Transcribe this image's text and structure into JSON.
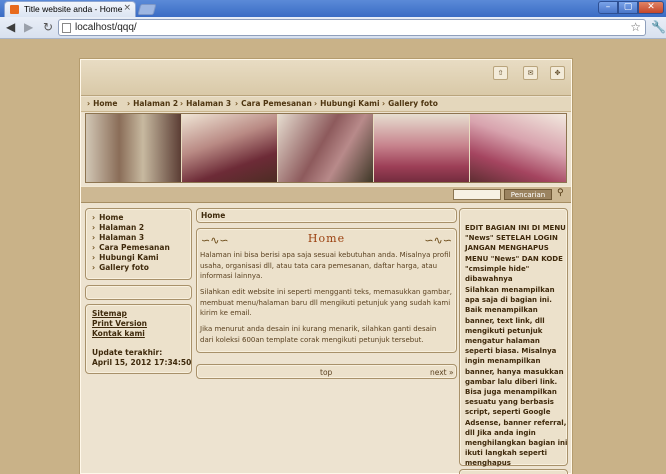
{
  "browser": {
    "tab_title": "Title website anda - Home",
    "tab_close": "×",
    "url": "localhost/qqq/",
    "controls": {
      "minimize": "–",
      "maximize": "▢",
      "close": "✕"
    },
    "nav": {
      "back": "◀",
      "forward": "▶",
      "reload": "↻",
      "star": "☆",
      "wrench": "🔧"
    }
  },
  "page": {
    "top_icons": [
      "⇧",
      "✉",
      "✥"
    ],
    "topnav": [
      "Home",
      "Halaman 2",
      "Halaman 3",
      "Cara Pemesanan",
      "Hubungi Kami",
      "Gallery foto"
    ],
    "arrow": "›",
    "search": {
      "button": "Pencarian",
      "icon": "⚲"
    },
    "sidebar": {
      "nav": [
        "Home",
        "Halaman 2",
        "Halaman 3",
        "Cara Pemesanan",
        "Hubungi Kami",
        "Gallery foto"
      ],
      "links": [
        "Sitemap",
        "Print Version",
        "Kontak kami"
      ],
      "updated_label": "Update terakhir:",
      "updated_value": "April 15, 2012 17:34:50"
    },
    "content": {
      "breadcrumb": "Home",
      "title": "Home",
      "paragraphs": [
        "Halaman ini bisa berisi apa saja sesuai kebutuhan anda. Misalnya profil usaha, organisasi dll, atau tata cara pemesanan, daftar harga, atau informasi lainnya.",
        "Silahkan edit website ini seperti mengganti teks, memasukkan gambar, membuat menu/halaman baru dll mengikuti petunjuk yang sudah kami kirim ke email.",
        "Jika menurut anda desain ini kurang menarik, silahkan ganti desain dari koleksi 600an template corak mengikuti petunjuk tersebut."
      ],
      "pager_top": "top",
      "pager_next": "next »"
    },
    "rightbox": {
      "heading": "EDIT BAGIAN INI DI MENU \"News\" SETELAH LOGIN JANGAN MENGHAPUS MENU \"News\" DAN KODE \"cmsimple hide\" dibawahnya",
      "body": "Silahkan menampilkan apa saja di bagian ini. Baik menampilkan banner, text link, dll mengikuti petunjuk mengatur halaman seperti biasa. Misalnya ingin menampilkan banner, hanya masukkan gambar lalu diberi link. Bisa juga menampilkan sesuatu yang berbasis script, seperti Google Adsense, banner referral, dll Jika anda ingin menghilangkan bagian ini ikuti langkah seperti menghapus menu/halaman seperti pada petunjuk."
    }
  }
}
